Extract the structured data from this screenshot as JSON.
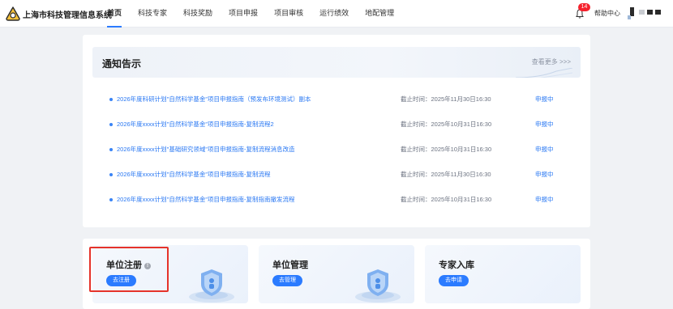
{
  "app": {
    "title": "上海市科技管理信息系统"
  },
  "nav": [
    {
      "label": "首页",
      "active": true
    },
    {
      "label": "科技专家",
      "active": false
    },
    {
      "label": "科技奖励",
      "active": false
    },
    {
      "label": "项目申报",
      "active": false
    },
    {
      "label": "项目审核",
      "active": false
    },
    {
      "label": "运行绩效",
      "active": false
    },
    {
      "label": "地配管理",
      "active": false
    }
  ],
  "header": {
    "notification_count": "14",
    "help_label": "帮助中心"
  },
  "notice": {
    "title": "通知告示",
    "more_label": "查看更多 >>>",
    "items": [
      {
        "title": "2026年度科研计划\"自然科学基金\"项目申报指南（预发布环境测试）副本",
        "deadline": "截止时间：2025年11月30日16:30",
        "status": "申报中"
      },
      {
        "title": "2026年度xxxx计划\"自然科学基金\"项目申报指南-复制流程2",
        "deadline": "截止时间：2025年10月31日16:30",
        "status": "申报中"
      },
      {
        "title": "2026年度xxxx计划\"基础研究领域\"项目申报指南-复制流程消息改造",
        "deadline": "截止时间：2025年10月31日16:30",
        "status": "申报中"
      },
      {
        "title": "2026年度xxxx计划\"自然科学基金\"项目申报指南-复制流程",
        "deadline": "截止时间：2025年11月30日16:30",
        "status": "申报中"
      },
      {
        "title": "2026年度xxxx计划\"自然科学基金\"项目申报指南-复制指南撤发流程",
        "deadline": "截止时间：2025年10月31日16:30",
        "status": "申报中"
      }
    ]
  },
  "cards": [
    {
      "title": "单位注册",
      "button": "去注册",
      "has_info_icon": true
    },
    {
      "title": "单位管理",
      "button": "去管理",
      "has_info_icon": false
    },
    {
      "title": "专家入库",
      "button": "去申请",
      "has_info_icon": false
    }
  ],
  "colors": {
    "accent": "#2b7bff",
    "badge": "#f5222d",
    "highlight": "#e5332a",
    "link": "#2a78f3"
  }
}
